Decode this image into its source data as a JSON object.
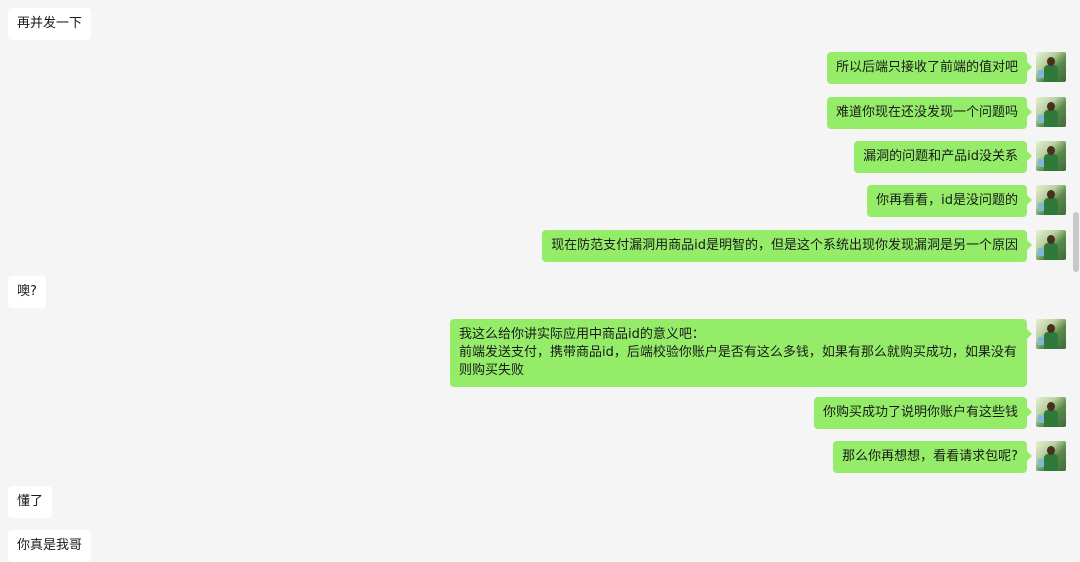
{
  "messages": [
    {
      "side": "left",
      "text": "再并发一下"
    },
    {
      "side": "right",
      "text": "所以后端只接收了前端的值对吧"
    },
    {
      "side": "right",
      "text": "难道你现在还没发现一个问题吗"
    },
    {
      "side": "right",
      "text": "漏洞的问题和产品id没关系"
    },
    {
      "side": "right",
      "text": "你再看看，id是没问题的"
    },
    {
      "side": "right",
      "text": "现在防范支付漏洞用商品id是明智的，但是这个系统出现你发现漏洞是另一个原因"
    },
    {
      "side": "left",
      "text": "噢?"
    },
    {
      "side": "right",
      "text": "我这么给你讲实际应用中商品id的意义吧：\n前端发送支付，携带商品id，后端校验你账户是否有这么多钱，如果有那么就购买成功，如果没有则购买失败"
    },
    {
      "side": "right",
      "text": "你购买成功了说明你账户有这些钱"
    },
    {
      "side": "right",
      "text": "那么你再想想，看看请求包呢?"
    },
    {
      "side": "left",
      "text": "懂了"
    },
    {
      "side": "left",
      "text": "你真是我哥"
    }
  ],
  "colors": {
    "background": "#f5f5f5",
    "sent_bubble": "#95ec69",
    "received_bubble": "#ffffff"
  },
  "icons": {
    "avatar": "user-avatar-icon"
  }
}
